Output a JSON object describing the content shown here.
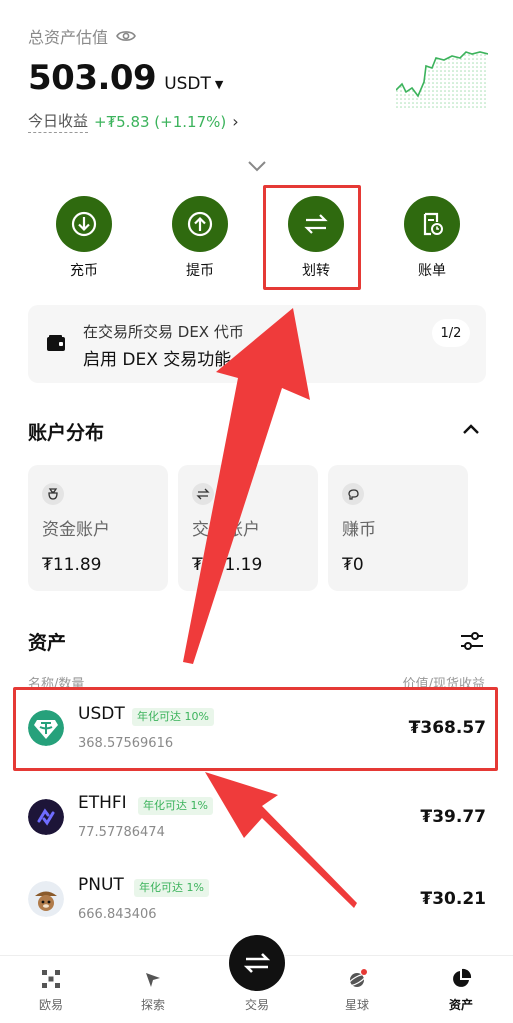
{
  "header": {
    "label": "总资产估值",
    "balance": "503.09",
    "unit": "USDT",
    "pnl_label": "今日收益",
    "pnl_value": "+₮5.83 (+1.17%)"
  },
  "actions": [
    {
      "label": "充币",
      "icon": "deposit-icon"
    },
    {
      "label": "提币",
      "icon": "withdraw-icon"
    },
    {
      "label": "划转",
      "icon": "transfer-icon"
    },
    {
      "label": "账单",
      "icon": "bill-icon"
    }
  ],
  "banner": {
    "line1": "在交易所交易 DEX 代币",
    "line2": "启用 DEX 交易功能",
    "page": "1/2"
  },
  "distribution": {
    "title": "账户分布",
    "accounts": [
      {
        "name": "资金账户",
        "value": "₮11.89",
        "icon": "bag-icon"
      },
      {
        "name": "交易账户",
        "value": "₮491.19",
        "icon": "swap-icon"
      },
      {
        "name": "赚币",
        "value": "₮0",
        "icon": "piggy-icon"
      }
    ]
  },
  "assets": {
    "title": "资产",
    "col_left": "名称/数量",
    "col_right": "价值/现货收益",
    "rows": [
      {
        "name": "USDT",
        "apy": "年化可达 10%",
        "amount": "368.57569616",
        "value": "₮368.57",
        "logo": "tether-logo"
      },
      {
        "name": "ETHFI",
        "apy": "年化可达 1%",
        "amount": "77.57786474",
        "value": "₮39.77",
        "logo": "ethfi-logo"
      },
      {
        "name": "PNUT",
        "apy": "年化可达 1%",
        "amount": "666.843406",
        "value": "₮30.21",
        "logo": "pnut-logo"
      }
    ]
  },
  "tabbar": {
    "tabs": [
      {
        "label": "欧易",
        "icon": "okx-icon"
      },
      {
        "label": "探索",
        "icon": "compass-icon"
      },
      {
        "label": "交易",
        "icon": "trade-icon"
      },
      {
        "label": "星球",
        "icon": "planet-icon"
      },
      {
        "label": "资产",
        "icon": "pie-chart-icon"
      }
    ],
    "active": "资产"
  },
  "colors": {
    "accent_green": "#2f6a0f",
    "profit_green": "#3cb35c",
    "annotation_red": "#e53935"
  }
}
